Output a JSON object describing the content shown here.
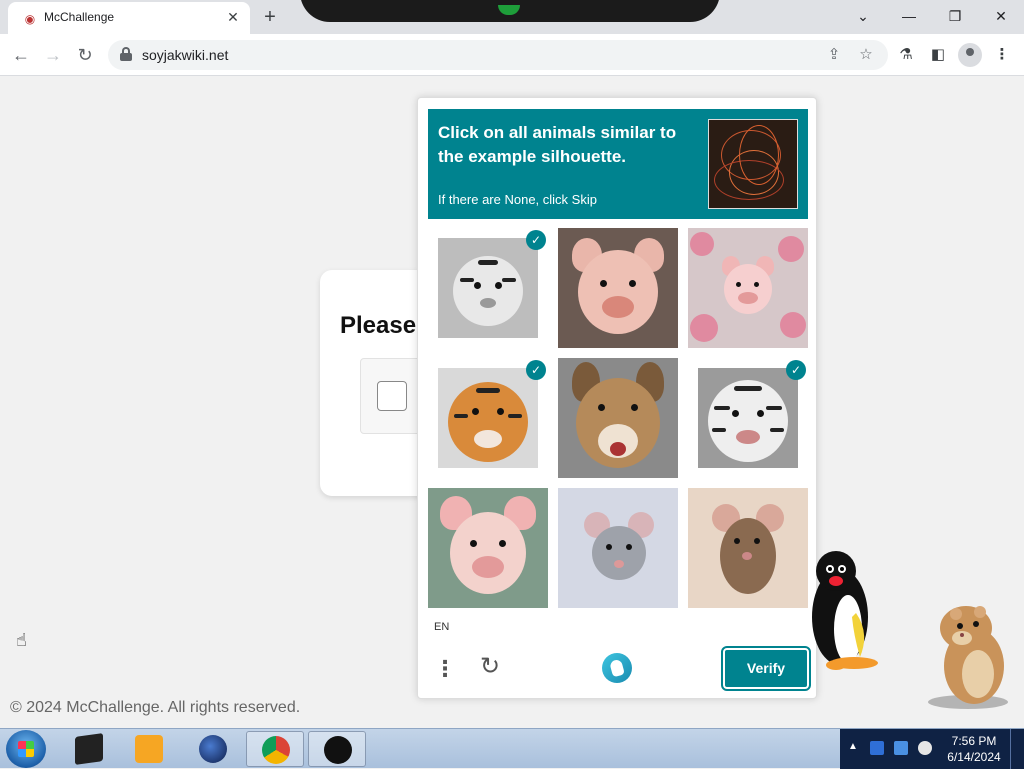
{
  "browser": {
    "tab_title": "McChallenge",
    "tab_close": "✕",
    "new_tab": "+",
    "url": "soyjakwiki.net",
    "window_controls": {
      "chevron": "⌄",
      "minimize": "—",
      "restore": "❐",
      "close": "✕"
    }
  },
  "page": {
    "card_title": "Please",
    "footer": "© 2024 McChallenge. All rights reserved."
  },
  "captcha": {
    "prompt": "Click on all animals similar to the example silhouette.",
    "subprompt": "If there are None, click Skip",
    "header_color": "#00838f",
    "tiles": [
      {
        "animal": "tiger",
        "selected": true
      },
      {
        "animal": "pig",
        "selected": false
      },
      {
        "animal": "pig with flowers",
        "selected": false
      },
      {
        "animal": "tiger",
        "selected": true
      },
      {
        "animal": "dog",
        "selected": false
      },
      {
        "animal": "white tiger",
        "selected": true
      },
      {
        "animal": "pig",
        "selected": false
      },
      {
        "animal": "mouse",
        "selected": false
      },
      {
        "animal": "mouse",
        "selected": false
      }
    ],
    "language": "EN",
    "verify_label": "Verify",
    "checkmark": "✓"
  },
  "taskbar": {
    "time": "7:56 PM",
    "date": "6/14/2024"
  }
}
